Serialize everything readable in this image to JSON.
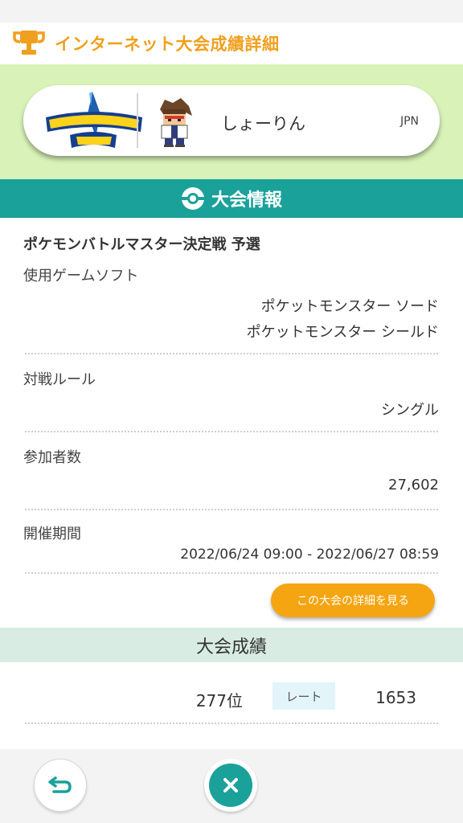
{
  "header": {
    "title": "インターネット大会成績詳細",
    "icon": "trophy-icon",
    "accent_color": "#f0a01e"
  },
  "profile": {
    "game_logo_text": "ポケットモンスター ソード",
    "trainer_name": "しょーりん",
    "region": "JPN"
  },
  "tournament_info": {
    "section_title": "大会情報",
    "competition_name": "ポケモンバトルマスター決定戦 予選",
    "game_software_label": "使用ゲームソフト",
    "game_software_values": [
      "ポケットモンスター ソード",
      "ポケットモンスター シールド"
    ],
    "battle_rule_label": "対戦ルール",
    "battle_rule_value": "シングル",
    "participants_label": "参加者数",
    "participants_value": "27,602",
    "period_label": "開催期間",
    "period_value": "2022/06/24 09:00 - 2022/06/27 08:59",
    "detail_button_label": "この大会の詳細を見る"
  },
  "results": {
    "section_title": "大会成績",
    "rank": "277位",
    "rate_label": "レート",
    "rate_value": "1653"
  },
  "colors": {
    "teal": "#1aa19a",
    "orange": "#f5a511",
    "light_green": "#d8f2b8"
  }
}
